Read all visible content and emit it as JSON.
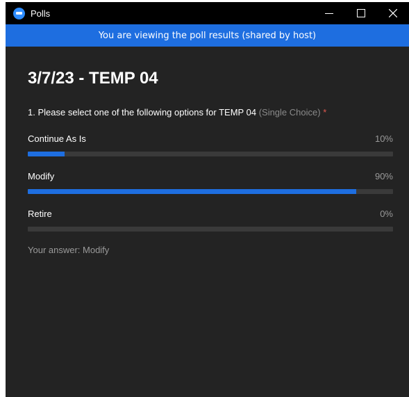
{
  "window": {
    "title": "Polls",
    "app_icon": "zoom-icon",
    "controls": [
      "minimize-icon",
      "maximize-icon",
      "close-icon"
    ]
  },
  "banner": {
    "text": "You are viewing the poll results (shared by host)"
  },
  "poll": {
    "title": "3/7/23 - TEMP 04",
    "question": {
      "text": "1. Please select one of the following options for TEMP 04",
      "type": "(Single Choice)",
      "required_marker": "*"
    },
    "options": [
      {
        "label": "Continue As Is",
        "percent_label": "10%",
        "percent": 10
      },
      {
        "label": "Modify",
        "percent_label": "90%",
        "percent": 90
      },
      {
        "label": "Retire",
        "percent_label": "0%",
        "percent": 0
      }
    ],
    "your_answer": "Your answer: Modify"
  },
  "colors": {
    "accent": "#1e6ee0",
    "background": "#232323",
    "titlebar": "#000000",
    "bar_track": "#3a3a3a",
    "required": "#e0584f"
  }
}
